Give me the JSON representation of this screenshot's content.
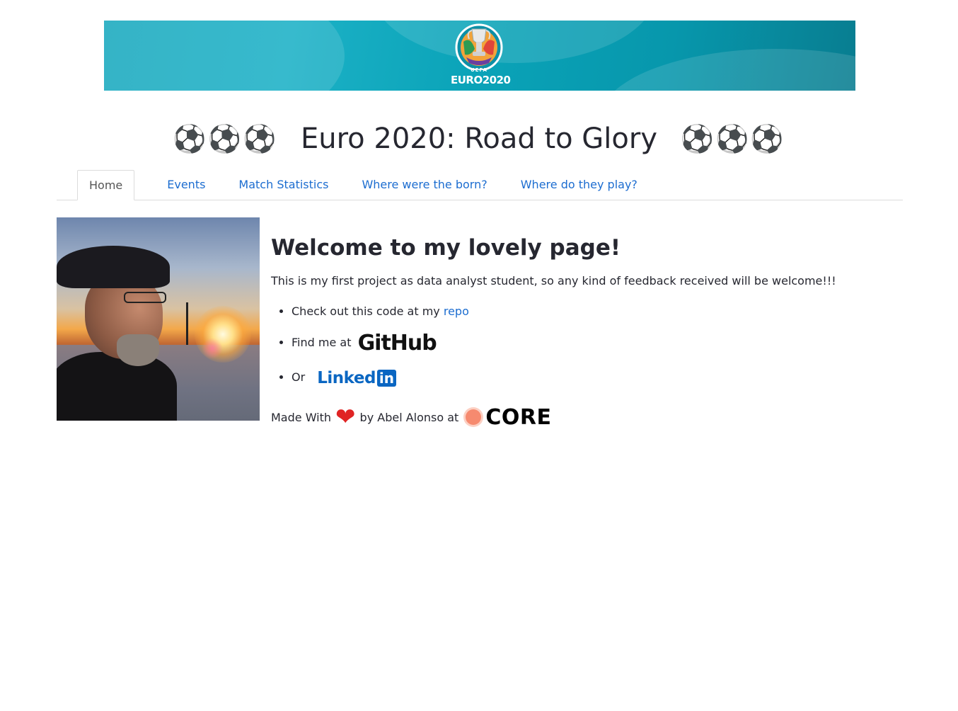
{
  "banner": {
    "logo_text": "EURO2020",
    "logo_subtext": "UEFA"
  },
  "title": {
    "balls_left": "⚽⚽⚽",
    "text": "Euro 2020: Road to Glory",
    "balls_right": "⚽⚽⚽"
  },
  "tabs": [
    {
      "label": "Home",
      "active": true
    },
    {
      "label": "Events",
      "active": false
    },
    {
      "label": "Match Statistics",
      "active": false
    },
    {
      "label": "Where were the born?",
      "active": false
    },
    {
      "label": "Where do they play?",
      "active": false
    }
  ],
  "main": {
    "heading": "Welcome to my lovely page!",
    "intro": "This is my first project as data analyst student, so any kind of feedback received will be welcome!!!",
    "links": {
      "repo_prefix": "Check out this code at my ",
      "repo_link": "repo",
      "github_prefix": "Find me at",
      "github_logo": "GitHub",
      "linkedin_prefix": "Or",
      "linkedin_word": "Linked",
      "linkedin_box": "in"
    },
    "made_with": {
      "prefix": "Made With",
      "heart": "❤",
      "middle": "by Abel Alonso at",
      "brand": "CORE"
    }
  },
  "colors": {
    "link": "#1c6dd0",
    "banner": "#0aa3b8",
    "heart": "#e02424",
    "core_dot": "#f68a6f",
    "linkedin": "#0a66c2"
  }
}
